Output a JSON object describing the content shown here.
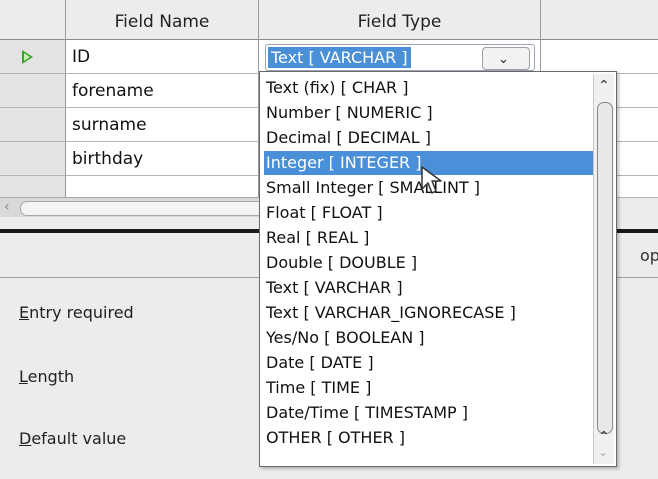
{
  "table": {
    "headers": {
      "field_name": "Field Name",
      "field_type": "Field Type"
    },
    "rows": [
      {
        "name": "ID"
      },
      {
        "name": "forename"
      },
      {
        "name": "surname"
      },
      {
        "name": "birthday"
      },
      {
        "name": ""
      }
    ],
    "current_type": "Text [ VARCHAR ]"
  },
  "dropdown": {
    "options": [
      "Text (fix) [ CHAR ]",
      "Number [ NUMERIC ]",
      "Decimal [ DECIMAL ]",
      "Integer [ INTEGER ]",
      "Small Integer [ SMALLINT ]",
      "Float [ FLOAT ]",
      "Real [ REAL ]",
      "Double [ DOUBLE ]",
      "Text [ VARCHAR ]",
      "Text [ VARCHAR_IGNORECASE ]",
      "Yes/No [ BOOLEAN ]",
      "Date [ DATE ]",
      "Time [ TIME ]",
      "Date/Time [ TIMESTAMP ]",
      "OTHER [ OTHER ]"
    ],
    "selected_index": 3
  },
  "properties": {
    "tab_partial": "op",
    "entry_required": {
      "mnemonic": "E",
      "rest": "ntry required"
    },
    "length": {
      "mnemonic": "L",
      "rest": "ength"
    },
    "default_value": {
      "mnemonic": "D",
      "rest": "efault value"
    }
  },
  "colors": {
    "selection": "#4a90d9",
    "active_row_arrow": "#3aa329"
  },
  "icons": {
    "row_marker": "play-arrow-icon",
    "combo": "chevron-down-icon"
  }
}
